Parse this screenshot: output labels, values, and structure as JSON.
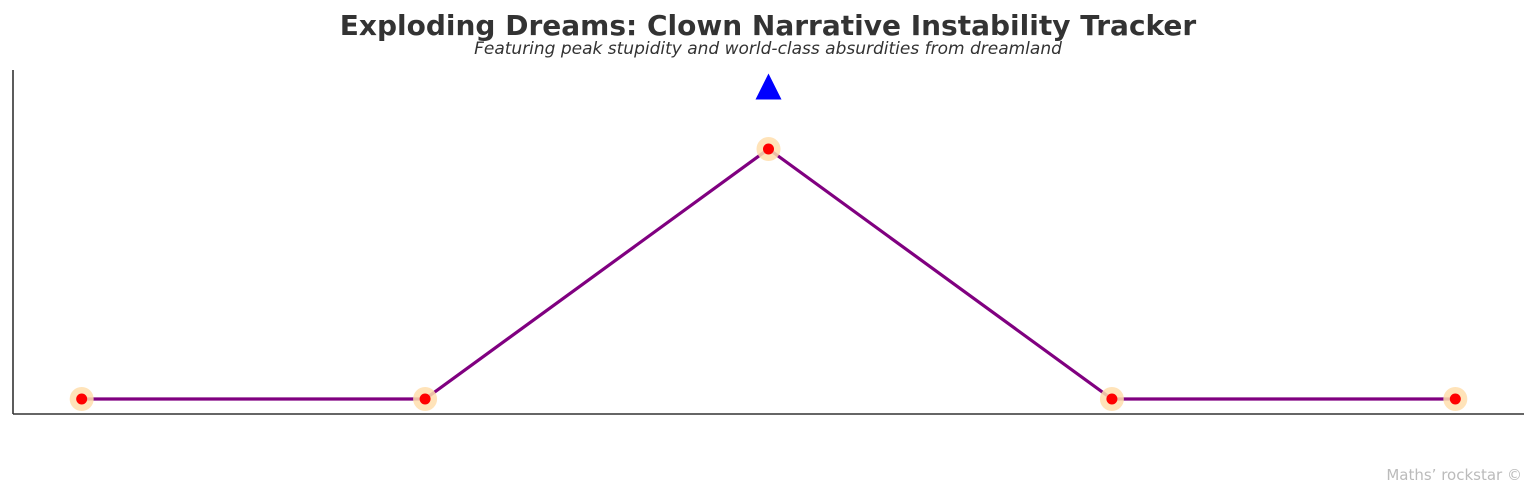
{
  "chart_data": {
    "type": "line",
    "title": "Exploding Dreams: Clown Narrative Instability Tracker",
    "subtitle": "Featuring peak stupidity and world-class absurdities from dreamland",
    "xlabel": "",
    "ylabel": "",
    "x": [
      0,
      1,
      2,
      3,
      4
    ],
    "series": [
      {
        "values": [
          0,
          0,
          1,
          0,
          0
        ]
      }
    ],
    "xlim": [
      -0.2,
      4.2
    ],
    "ylim": [
      -0.06,
      1.316
    ],
    "grid": false,
    "ticks_visible": false,
    "annotations": [
      {
        "type": "triangle-marker",
        "x": 2,
        "y": 1.25,
        "color": "#0000ff"
      }
    ],
    "colors": {
      "line": "#800080",
      "marker": "#ff0000",
      "marker_halo": "#ffdead",
      "text": "#333333"
    },
    "watermark": "Maths’ rockstar ©"
  }
}
